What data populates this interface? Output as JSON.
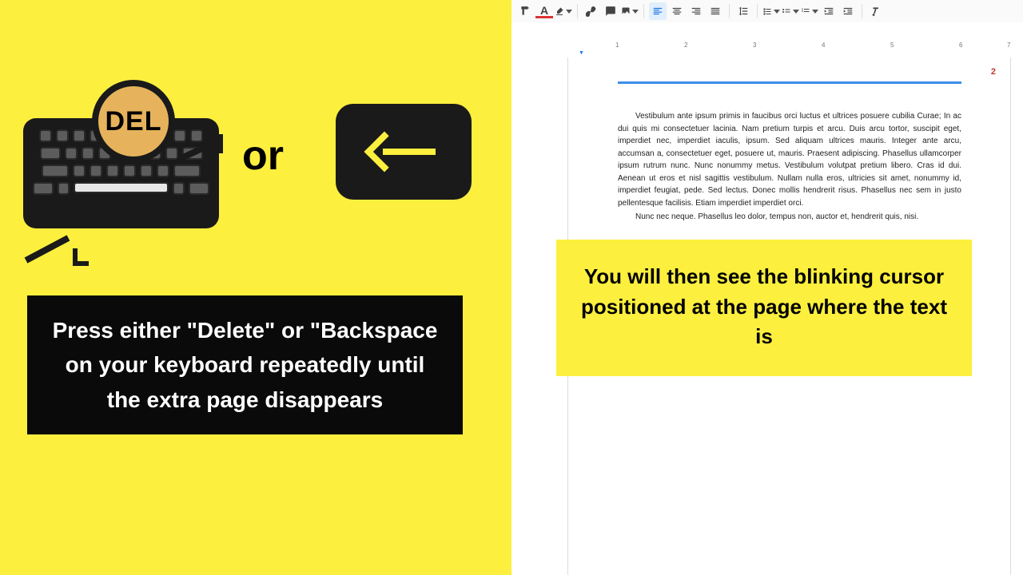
{
  "left": {
    "del_label": "DEL",
    "or_label": "or",
    "instruction": "Press either \"Delete\" or \"Backspace on your keyboard repeatedly until the extra page disappears"
  },
  "right": {
    "page_number": "2",
    "doc_para1": "Vestibulum ante ipsum primis in faucibus orci luctus et ultrices posuere cubilia Curae; In ac dui quis mi consectetuer lacinia. Nam pretium turpis et arcu. Duis arcu tortor, suscipit eget, imperdiet nec, imperdiet iaculis, ipsum. Sed aliquam ultrices mauris. Integer ante arcu, accumsan a, consectetuer eget, posuere ut, mauris. Praesent adipiscing. Phasellus ullamcorper ipsum rutrum nunc. Nunc nonummy metus. Vestibulum volutpat pretium libero. Cras id dui. Aenean ut eros et nisl sagittis vestibulum. Nullam nulla eros, ultricies sit amet, nonummy id, imperdiet feugiat, pede. Sed lectus. Donec mollis hendrerit risus. Phasellus nec sem in justo pellentesque facilisis. Etiam imperdiet imperdiet orci.",
    "doc_para2": "Nunc nec neque. Phasellus leo dolor, tempus non, auctor et, hendrerit quis, nisi.",
    "callout": "You will then see the blinking cursor positioned at the page where the text is",
    "ruler_marks": [
      "1",
      "2",
      "3",
      "4",
      "5",
      "6",
      "7"
    ]
  },
  "toolbar": {
    "format_painter": "Format",
    "text_color": "A"
  }
}
